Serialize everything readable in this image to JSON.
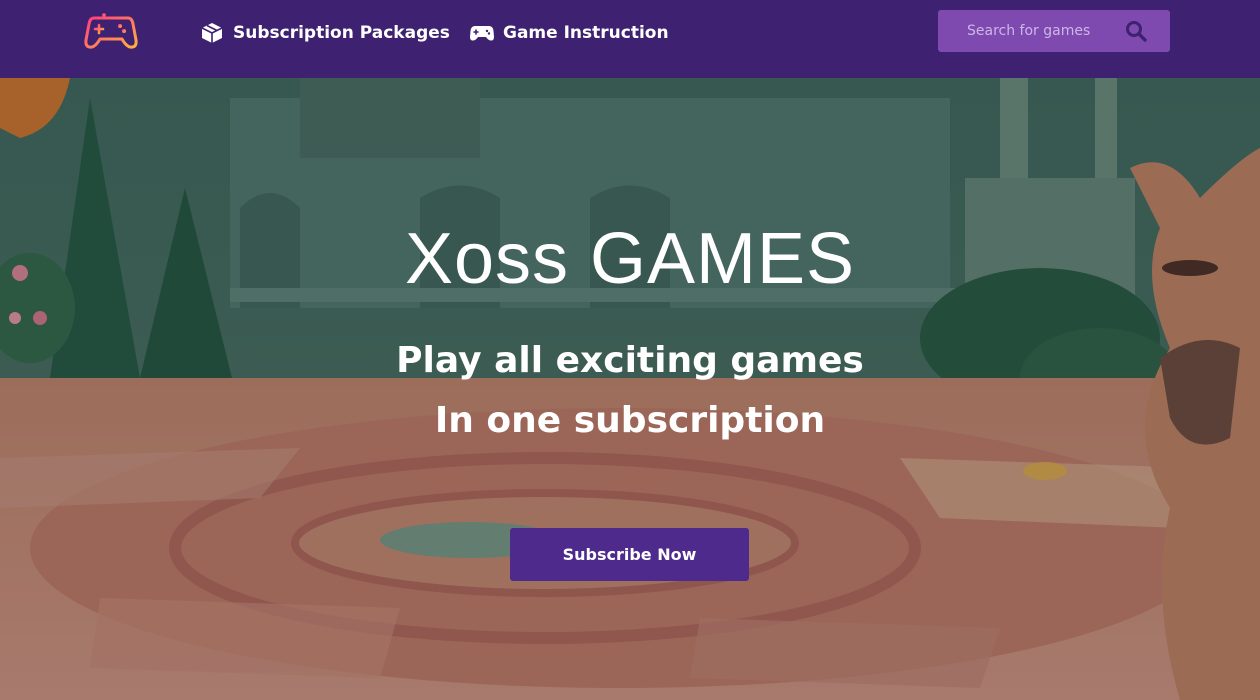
{
  "nav": {
    "logo_icon": "gamepad-logo-icon",
    "links": [
      {
        "label": "Subscription Packages",
        "icon": "box-icon"
      },
      {
        "label": "Game Instruction",
        "icon": "gamepad-icon"
      }
    ]
  },
  "search": {
    "placeholder": "Search for games",
    "value": "",
    "icon": "search-icon"
  },
  "hero": {
    "title": "Xoss GAMES",
    "line1": "Play all exciting games",
    "line2": "In one subscription",
    "cta_label": "Subscribe Now"
  },
  "colors": {
    "navbar": "#3e2170",
    "search_bg": "#7e4ab0",
    "cta_bg": "#4e2a8c",
    "logo_gradient_start": "#ff3d7f",
    "logo_gradient_end": "#ffb23f"
  }
}
